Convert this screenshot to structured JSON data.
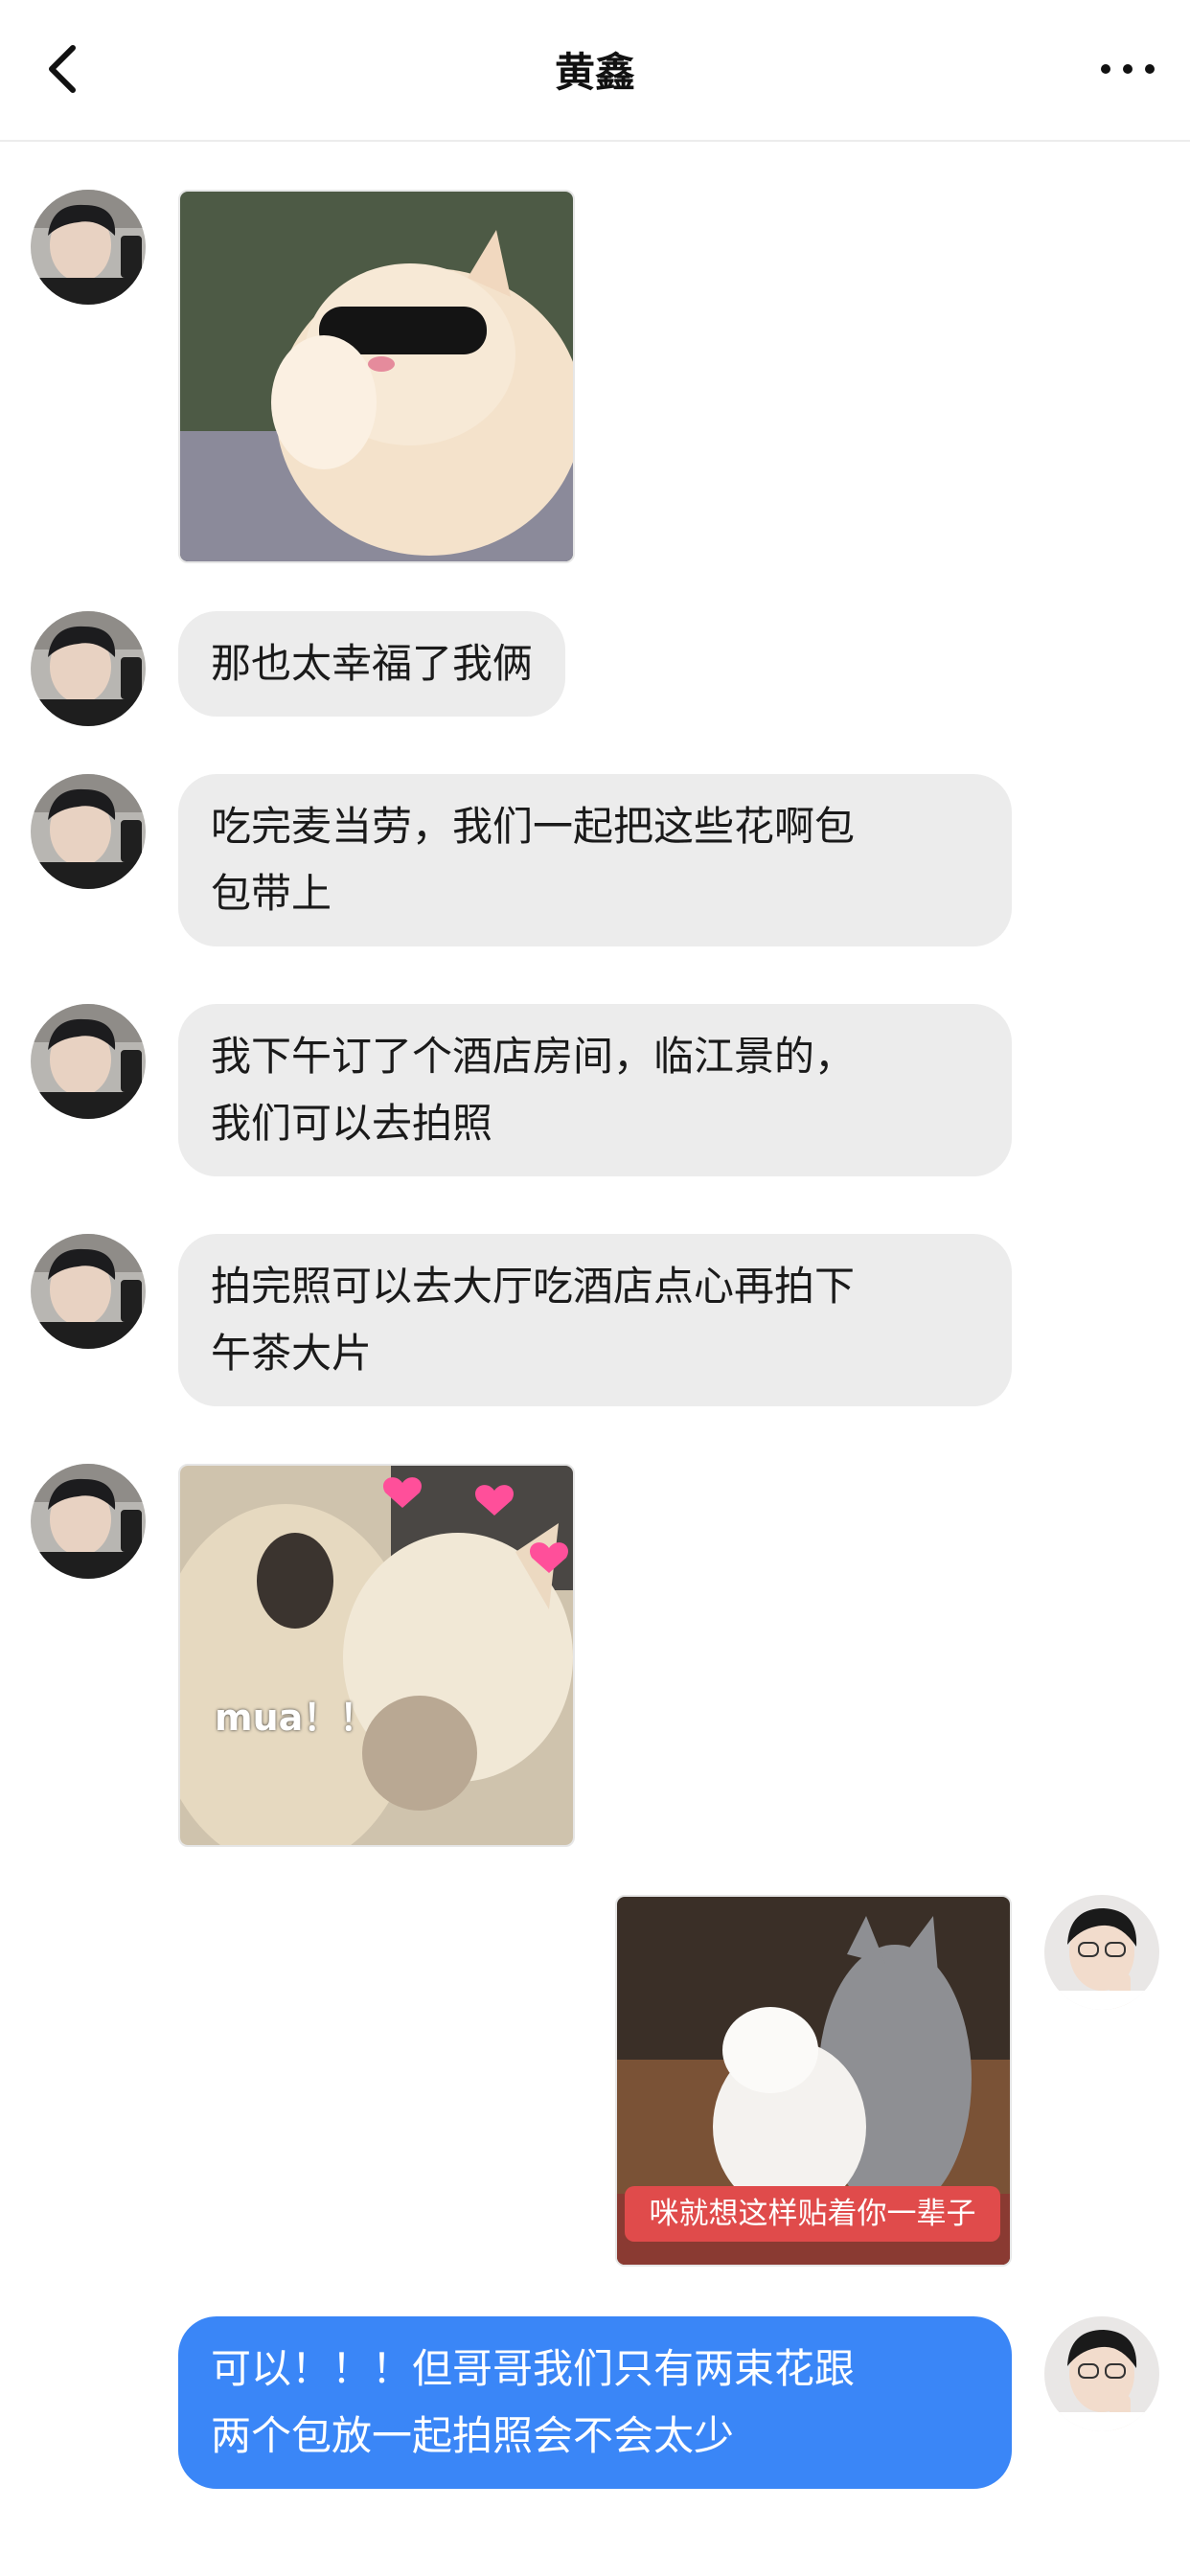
{
  "header": {
    "title": "黄鑫"
  },
  "messages": [
    {
      "side": "left",
      "type": "sticker",
      "sticker": "cat-with-sunglasses"
    },
    {
      "side": "left",
      "type": "text",
      "text": "那也太幸福了我俩"
    },
    {
      "side": "left",
      "type": "text",
      "line1": "吃完麦当劳，我们一起把这些花啊包",
      "line2": "包带上"
    },
    {
      "side": "left",
      "type": "text",
      "line1": "我下午订了个酒店房间，临江景的，",
      "line2": "我们可以去拍照"
    },
    {
      "side": "left",
      "type": "text",
      "line1": "拍完照可以去大厅吃酒店点心再拍下",
      "line2": "午茶大片"
    },
    {
      "side": "left",
      "type": "sticker",
      "sticker": "cats-kissing",
      "caption": "mua！！"
    },
    {
      "side": "right",
      "type": "sticker",
      "sticker": "two-cats-cuddling",
      "caption": "咪就想这样贴着你一辈子"
    },
    {
      "side": "right",
      "type": "text",
      "line1": "可以！！！但哥哥我们只有两束花跟",
      "line2": "两个包放一起拍照会不会太少"
    }
  ],
  "colors": {
    "outgoing_bubble": "#3a86f7",
    "incoming_bubble": "#ececec",
    "sticker_caption_tag": "#e04b4b"
  },
  "icons": [
    "back-arrow-icon",
    "more-options-icon",
    "heart-icon"
  ]
}
